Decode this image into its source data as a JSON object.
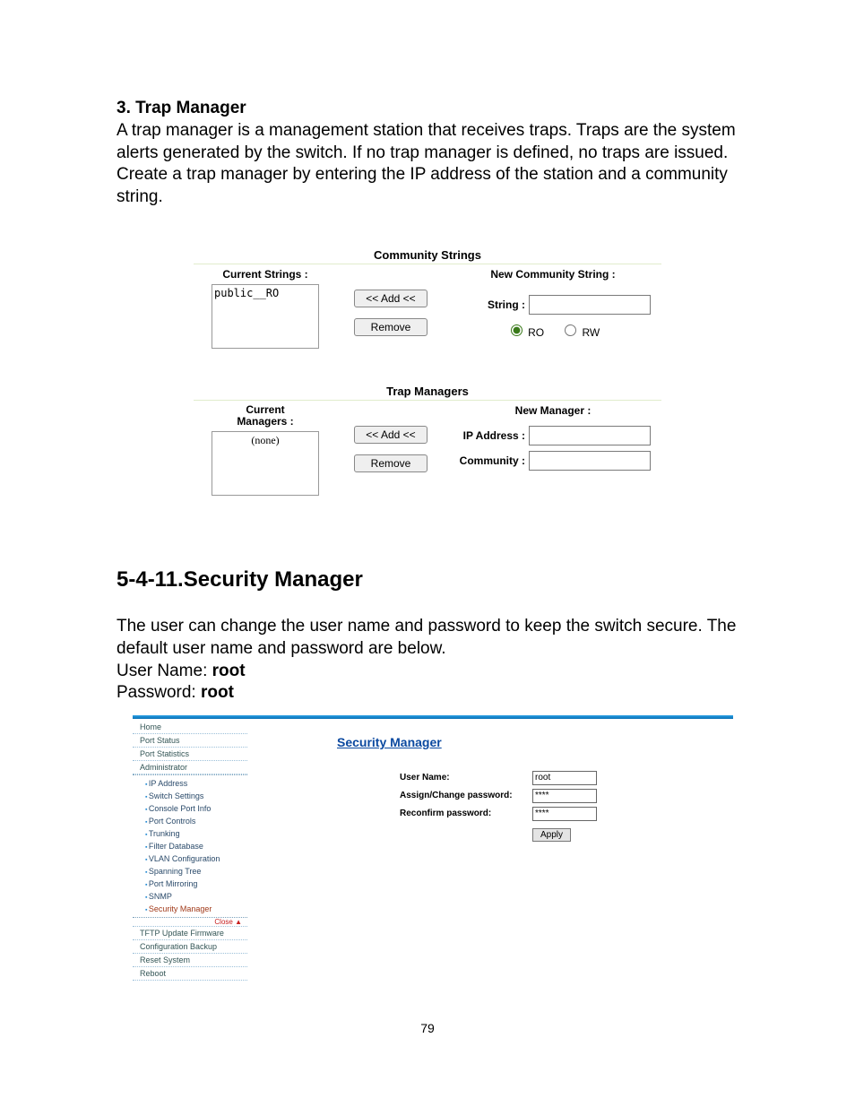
{
  "section1": {
    "heading": "3. Trap Manager",
    "paragraph": "A trap manager is a management station that receives traps.  Traps are the system alerts generated by the switch. If no trap manager is defined, no traps are issued. Create a trap manager by entering the IP address of the station and a community string."
  },
  "fig1": {
    "comm_title": "Community Strings",
    "current_strings_label": "Current Strings :",
    "current_strings_value": "public__RO",
    "new_comm_label": "New Community String :",
    "string_label": "String :",
    "add_btn": "<< Add <<",
    "remove_btn": "Remove",
    "ro_label": "RO",
    "rw_label": "RW",
    "trap_title": "Trap Managers",
    "current_managers_label": "Current Managers :",
    "current_managers_value": "(none)",
    "new_manager_label": "New Manager :",
    "ip_label": "IP Address :",
    "community_label": "Community :"
  },
  "section2": {
    "heading": "5-4-11.Security Manager",
    "p1": "The user can change the user name and password to keep the switch secure.  The default user name and password are below.",
    "un_label": "User Name: ",
    "un_value": "root",
    "pw_label": "Password: ",
    "pw_value": "root"
  },
  "fig2": {
    "menu": {
      "home": "Home",
      "port_status": "Port Status",
      "port_stats": "Port Statistics",
      "admin": "Administrator",
      "sub": {
        "ip": "IP Address",
        "switch": "Switch Settings",
        "console": "Console Port Info",
        "portctl": "Port Controls",
        "trunking": "Trunking",
        "filter": "Filter Database",
        "vlan": "VLAN Configuration",
        "spanning": "Spanning Tree",
        "mirror": "Port Mirroring",
        "snmp": "SNMP",
        "secmgr": "Security Manager"
      },
      "close": "Close ▲",
      "tftp": "TFTP Update Firmware",
      "backup": "Configuration Backup",
      "reset": "Reset System",
      "reboot": "Reboot"
    },
    "content": {
      "title": "Security Manager",
      "user_name_label": "User Name:",
      "user_name_value": "root",
      "assign_label": "Assign/Change password:",
      "assign_value": "****",
      "reconfirm_label": "Reconfirm password:",
      "reconfirm_value": "****",
      "apply": "Apply"
    }
  },
  "page_number": "79"
}
